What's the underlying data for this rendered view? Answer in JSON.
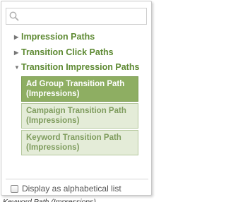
{
  "search": {
    "value": "",
    "placeholder": ""
  },
  "categories": [
    {
      "label": "Impression Paths",
      "expanded": false
    },
    {
      "label": "Transition Click Paths",
      "expanded": false
    },
    {
      "label": "Transition Impression Paths",
      "expanded": true
    }
  ],
  "items": [
    {
      "label": "Ad Group Transition Path (Impressions)",
      "selected": true
    },
    {
      "label": "Campaign Transition Path (Impressions)",
      "selected": false
    },
    {
      "label": "Keyword Transition Path (Impressions)",
      "selected": false
    }
  ],
  "options": {
    "alphabetical_label": "Display as alphabetical list",
    "alphabetical_checked": false
  },
  "below_text": "Keyword Path (Impressions)",
  "colors": {
    "accent_green": "#5e8a33",
    "selected_bg": "#8eae62",
    "item_bg": "#e4ecd8"
  },
  "icons": {
    "search": "search-icon",
    "collapsed": "triangle-right-icon",
    "expanded": "triangle-down-icon"
  }
}
